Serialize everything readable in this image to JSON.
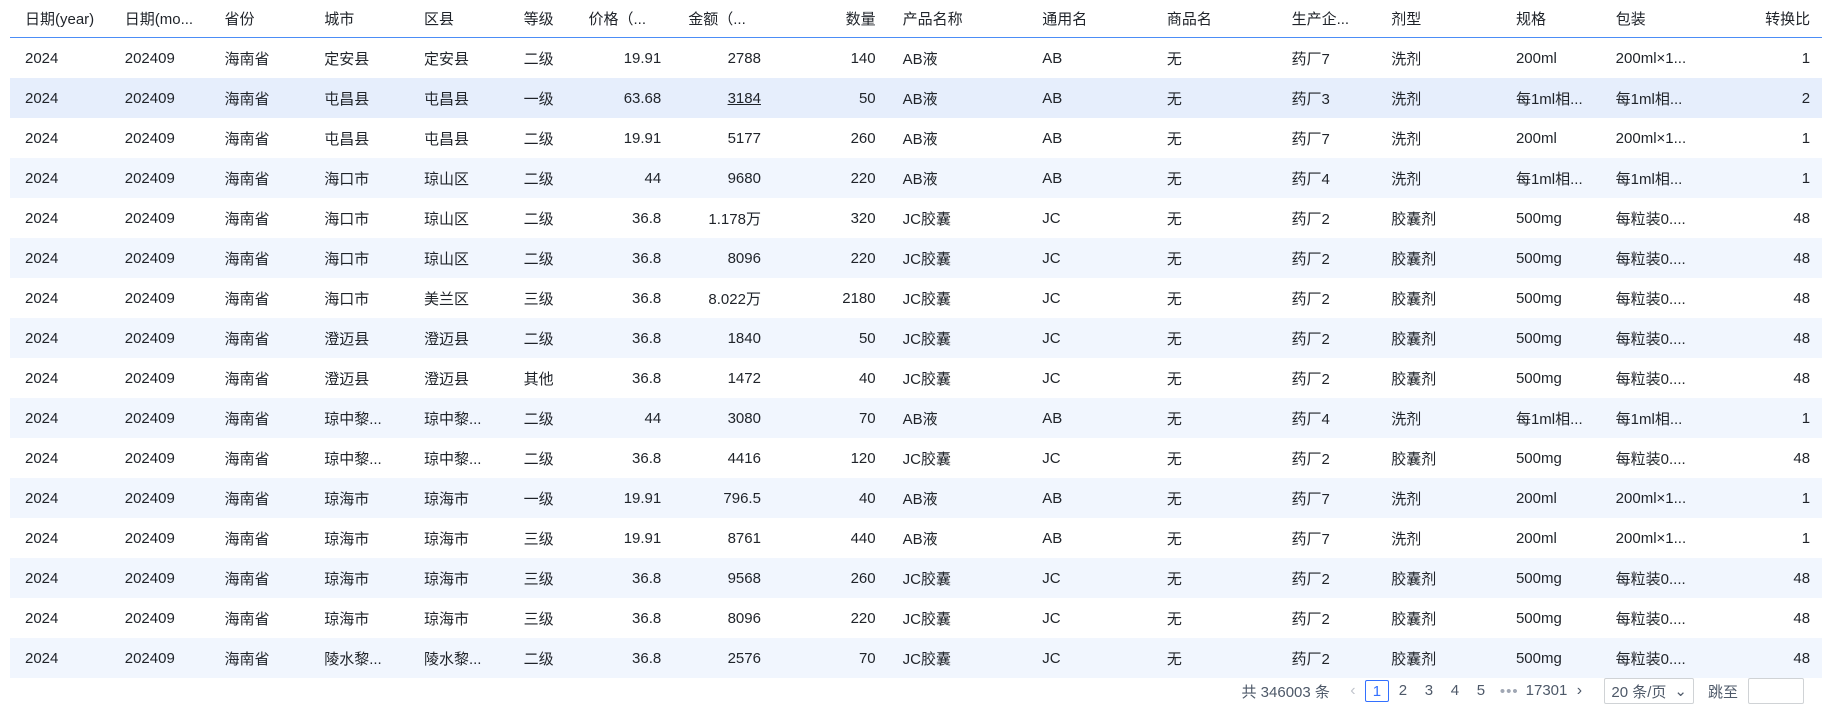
{
  "table": {
    "columns": [
      {
        "key": "year",
        "label": "日期(year)",
        "w": 100
      },
      {
        "key": "month",
        "label": "日期(mo...",
        "w": 100
      },
      {
        "key": "province",
        "label": "省份",
        "w": 100
      },
      {
        "key": "city",
        "label": "城市",
        "w": 100
      },
      {
        "key": "district",
        "label": "区县",
        "w": 100
      },
      {
        "key": "level",
        "label": "等级",
        "w": 65
      },
      {
        "key": "price",
        "label": "价格（...",
        "w": 100,
        "right": false
      },
      {
        "key": "amount",
        "label": "金额（...",
        "w": 100
      },
      {
        "key": "qty",
        "label": "数量",
        "w": 115,
        "right": true
      },
      {
        "key": "product",
        "label": "产品名称",
        "w": 140
      },
      {
        "key": "generic",
        "label": "通用名",
        "w": 125
      },
      {
        "key": "trade",
        "label": "商品名",
        "w": 125
      },
      {
        "key": "maker",
        "label": "生产企...",
        "w": 100
      },
      {
        "key": "form",
        "label": "剂型",
        "w": 125
      },
      {
        "key": "spec",
        "label": "规格",
        "w": 100
      },
      {
        "key": "pack",
        "label": "包装",
        "w": 100
      },
      {
        "key": "ratio",
        "label": "转换比",
        "w": 122,
        "right": true
      }
    ],
    "rows": [
      [
        "2024",
        "202409",
        "海南省",
        "定安县",
        "定安县",
        "二级",
        "19.91",
        "2788",
        "140",
        "AB液",
        "AB",
        "无",
        "药厂7",
        "洗剂",
        "200ml",
        "200ml×1...",
        "1"
      ],
      [
        "2024",
        "202409",
        "海南省",
        "屯昌县",
        "屯昌县",
        "一级",
        "63.68",
        "3184",
        "50",
        "AB液",
        "AB",
        "无",
        "药厂3",
        "洗剂",
        "每1ml相...",
        "每1ml相...",
        "2"
      ],
      [
        "2024",
        "202409",
        "海南省",
        "屯昌县",
        "屯昌县",
        "二级",
        "19.91",
        "5177",
        "260",
        "AB液",
        "AB",
        "无",
        "药厂7",
        "洗剂",
        "200ml",
        "200ml×1...",
        "1"
      ],
      [
        "2024",
        "202409",
        "海南省",
        "海口市",
        "琼山区",
        "二级",
        "44",
        "9680",
        "220",
        "AB液",
        "AB",
        "无",
        "药厂4",
        "洗剂",
        "每1ml相...",
        "每1ml相...",
        "1"
      ],
      [
        "2024",
        "202409",
        "海南省",
        "海口市",
        "琼山区",
        "二级",
        "36.8",
        "1.178万",
        "320",
        "JC胶囊",
        "JC",
        "无",
        "药厂2",
        "胶囊剂",
        "500mg",
        "每粒装0....",
        "48"
      ],
      [
        "2024",
        "202409",
        "海南省",
        "海口市",
        "琼山区",
        "二级",
        "36.8",
        "8096",
        "220",
        "JC胶囊",
        "JC",
        "无",
        "药厂2",
        "胶囊剂",
        "500mg",
        "每粒装0....",
        "48"
      ],
      [
        "2024",
        "202409",
        "海南省",
        "海口市",
        "美兰区",
        "三级",
        "36.8",
        "8.022万",
        "2180",
        "JC胶囊",
        "JC",
        "无",
        "药厂2",
        "胶囊剂",
        "500mg",
        "每粒装0....",
        "48"
      ],
      [
        "2024",
        "202409",
        "海南省",
        "澄迈县",
        "澄迈县",
        "二级",
        "36.8",
        "1840",
        "50",
        "JC胶囊",
        "JC",
        "无",
        "药厂2",
        "胶囊剂",
        "500mg",
        "每粒装0....",
        "48"
      ],
      [
        "2024",
        "202409",
        "海南省",
        "澄迈县",
        "澄迈县",
        "其他",
        "36.8",
        "1472",
        "40",
        "JC胶囊",
        "JC",
        "无",
        "药厂2",
        "胶囊剂",
        "500mg",
        "每粒装0....",
        "48"
      ],
      [
        "2024",
        "202409",
        "海南省",
        "琼中黎...",
        "琼中黎...",
        "二级",
        "44",
        "3080",
        "70",
        "AB液",
        "AB",
        "无",
        "药厂4",
        "洗剂",
        "每1ml相...",
        "每1ml相...",
        "1"
      ],
      [
        "2024",
        "202409",
        "海南省",
        "琼中黎...",
        "琼中黎...",
        "二级",
        "36.8",
        "4416",
        "120",
        "JC胶囊",
        "JC",
        "无",
        "药厂2",
        "胶囊剂",
        "500mg",
        "每粒装0....",
        "48"
      ],
      [
        "2024",
        "202409",
        "海南省",
        "琼海市",
        "琼海市",
        "一级",
        "19.91",
        "796.5",
        "40",
        "AB液",
        "AB",
        "无",
        "药厂7",
        "洗剂",
        "200ml",
        "200ml×1...",
        "1"
      ],
      [
        "2024",
        "202409",
        "海南省",
        "琼海市",
        "琼海市",
        "三级",
        "19.91",
        "8761",
        "440",
        "AB液",
        "AB",
        "无",
        "药厂7",
        "洗剂",
        "200ml",
        "200ml×1...",
        "1"
      ],
      [
        "2024",
        "202409",
        "海南省",
        "琼海市",
        "琼海市",
        "三级",
        "36.8",
        "9568",
        "260",
        "JC胶囊",
        "JC",
        "无",
        "药厂2",
        "胶囊剂",
        "500mg",
        "每粒装0....",
        "48"
      ],
      [
        "2024",
        "202409",
        "海南省",
        "琼海市",
        "琼海市",
        "三级",
        "36.8",
        "8096",
        "220",
        "JC胶囊",
        "JC",
        "无",
        "药厂2",
        "胶囊剂",
        "500mg",
        "每粒装0....",
        "48"
      ],
      [
        "2024",
        "202409",
        "海南省",
        "陵水黎...",
        "陵水黎...",
        "二级",
        "36.8",
        "2576",
        "70",
        "JC胶囊",
        "JC",
        "无",
        "药厂2",
        "胶囊剂",
        "500mg",
        "每粒装0....",
        "48"
      ]
    ]
  },
  "pagination": {
    "total_text": "共 346003 条",
    "pages": [
      "1",
      "2",
      "3",
      "4",
      "5"
    ],
    "current": "1",
    "ellipsis": "•••",
    "last_page": "17301",
    "page_size": "20 条/页",
    "jump_label": "跳至"
  },
  "colors": {
    "accent": "#3370ff",
    "stripe": "#f1f6fe",
    "header_line": "#4c8df6"
  }
}
